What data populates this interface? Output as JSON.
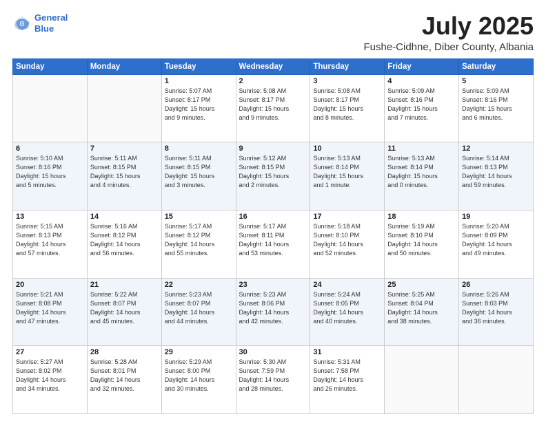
{
  "header": {
    "logo_line1": "General",
    "logo_line2": "Blue",
    "month": "July 2025",
    "location": "Fushe-Cidhne, Diber County, Albania"
  },
  "weekdays": [
    "Sunday",
    "Monday",
    "Tuesday",
    "Wednesday",
    "Thursday",
    "Friday",
    "Saturday"
  ],
  "weeks": [
    [
      {
        "day": "",
        "info": ""
      },
      {
        "day": "",
        "info": ""
      },
      {
        "day": "1",
        "info": "Sunrise: 5:07 AM\nSunset: 8:17 PM\nDaylight: 15 hours\nand 9 minutes."
      },
      {
        "day": "2",
        "info": "Sunrise: 5:08 AM\nSunset: 8:17 PM\nDaylight: 15 hours\nand 9 minutes."
      },
      {
        "day": "3",
        "info": "Sunrise: 5:08 AM\nSunset: 8:17 PM\nDaylight: 15 hours\nand 8 minutes."
      },
      {
        "day": "4",
        "info": "Sunrise: 5:09 AM\nSunset: 8:16 PM\nDaylight: 15 hours\nand 7 minutes."
      },
      {
        "day": "5",
        "info": "Sunrise: 5:09 AM\nSunset: 8:16 PM\nDaylight: 15 hours\nand 6 minutes."
      }
    ],
    [
      {
        "day": "6",
        "info": "Sunrise: 5:10 AM\nSunset: 8:16 PM\nDaylight: 15 hours\nand 5 minutes."
      },
      {
        "day": "7",
        "info": "Sunrise: 5:11 AM\nSunset: 8:15 PM\nDaylight: 15 hours\nand 4 minutes."
      },
      {
        "day": "8",
        "info": "Sunrise: 5:11 AM\nSunset: 8:15 PM\nDaylight: 15 hours\nand 3 minutes."
      },
      {
        "day": "9",
        "info": "Sunrise: 5:12 AM\nSunset: 8:15 PM\nDaylight: 15 hours\nand 2 minutes."
      },
      {
        "day": "10",
        "info": "Sunrise: 5:13 AM\nSunset: 8:14 PM\nDaylight: 15 hours\nand 1 minute."
      },
      {
        "day": "11",
        "info": "Sunrise: 5:13 AM\nSunset: 8:14 PM\nDaylight: 15 hours\nand 0 minutes."
      },
      {
        "day": "12",
        "info": "Sunrise: 5:14 AM\nSunset: 8:13 PM\nDaylight: 14 hours\nand 59 minutes."
      }
    ],
    [
      {
        "day": "13",
        "info": "Sunrise: 5:15 AM\nSunset: 8:13 PM\nDaylight: 14 hours\nand 57 minutes."
      },
      {
        "day": "14",
        "info": "Sunrise: 5:16 AM\nSunset: 8:12 PM\nDaylight: 14 hours\nand 56 minutes."
      },
      {
        "day": "15",
        "info": "Sunrise: 5:17 AM\nSunset: 8:12 PM\nDaylight: 14 hours\nand 55 minutes."
      },
      {
        "day": "16",
        "info": "Sunrise: 5:17 AM\nSunset: 8:11 PM\nDaylight: 14 hours\nand 53 minutes."
      },
      {
        "day": "17",
        "info": "Sunrise: 5:18 AM\nSunset: 8:10 PM\nDaylight: 14 hours\nand 52 minutes."
      },
      {
        "day": "18",
        "info": "Sunrise: 5:19 AM\nSunset: 8:10 PM\nDaylight: 14 hours\nand 50 minutes."
      },
      {
        "day": "19",
        "info": "Sunrise: 5:20 AM\nSunset: 8:09 PM\nDaylight: 14 hours\nand 49 minutes."
      }
    ],
    [
      {
        "day": "20",
        "info": "Sunrise: 5:21 AM\nSunset: 8:08 PM\nDaylight: 14 hours\nand 47 minutes."
      },
      {
        "day": "21",
        "info": "Sunrise: 5:22 AM\nSunset: 8:07 PM\nDaylight: 14 hours\nand 45 minutes."
      },
      {
        "day": "22",
        "info": "Sunrise: 5:23 AM\nSunset: 8:07 PM\nDaylight: 14 hours\nand 44 minutes."
      },
      {
        "day": "23",
        "info": "Sunrise: 5:23 AM\nSunset: 8:06 PM\nDaylight: 14 hours\nand 42 minutes."
      },
      {
        "day": "24",
        "info": "Sunrise: 5:24 AM\nSunset: 8:05 PM\nDaylight: 14 hours\nand 40 minutes."
      },
      {
        "day": "25",
        "info": "Sunrise: 5:25 AM\nSunset: 8:04 PM\nDaylight: 14 hours\nand 38 minutes."
      },
      {
        "day": "26",
        "info": "Sunrise: 5:26 AM\nSunset: 8:03 PM\nDaylight: 14 hours\nand 36 minutes."
      }
    ],
    [
      {
        "day": "27",
        "info": "Sunrise: 5:27 AM\nSunset: 8:02 PM\nDaylight: 14 hours\nand 34 minutes."
      },
      {
        "day": "28",
        "info": "Sunrise: 5:28 AM\nSunset: 8:01 PM\nDaylight: 14 hours\nand 32 minutes."
      },
      {
        "day": "29",
        "info": "Sunrise: 5:29 AM\nSunset: 8:00 PM\nDaylight: 14 hours\nand 30 minutes."
      },
      {
        "day": "30",
        "info": "Sunrise: 5:30 AM\nSunset: 7:59 PM\nDaylight: 14 hours\nand 28 minutes."
      },
      {
        "day": "31",
        "info": "Sunrise: 5:31 AM\nSunset: 7:58 PM\nDaylight: 14 hours\nand 26 minutes."
      },
      {
        "day": "",
        "info": ""
      },
      {
        "day": "",
        "info": ""
      }
    ]
  ]
}
